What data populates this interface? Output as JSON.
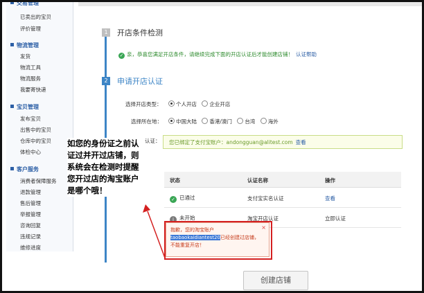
{
  "sidebar": {
    "groups": [
      {
        "head": "交易管理",
        "items": [
          "已卖出的宝贝",
          "评价管理"
        ]
      },
      {
        "head": "物流管理",
        "items": [
          "发货",
          "物流工具",
          "物流服务",
          "我要寄快递"
        ]
      },
      {
        "head": "宝贝管理",
        "items": [
          "发布宝贝",
          "出售中的宝贝",
          "仓库中的宝贝",
          "体检中心"
        ]
      },
      {
        "head": "客户服务",
        "items": [
          "消费者保障服务",
          "退款管理",
          "售后管理",
          "举报管理",
          "咨询回复",
          "违规记录",
          "维修进度"
        ]
      }
    ]
  },
  "steps": [
    {
      "num": "1",
      "title": "开店条件检测"
    },
    {
      "num": "2",
      "title": "申请开店认证"
    }
  ],
  "notice": {
    "message": "亲，恭喜您满足开店条件，请继续完成下面的开店认证后才能创建店铺！",
    "link": "认证帮助"
  },
  "form": {
    "shop_type_label": "选择开店类型：",
    "shop_type_options": [
      "个人开店",
      "企业开店"
    ],
    "location_label": "选择所在地：",
    "location_options": [
      "中国大陆",
      "香港/澳门",
      "台湾",
      "海外"
    ],
    "auth_label": "认证：",
    "alipay_text": "您已绑定了支付宝账户：andongguan@alitest.com",
    "alipay_link": "查看"
  },
  "table": {
    "headers": [
      "状态",
      "认证名称",
      "操作"
    ],
    "rows": [
      {
        "status": "已通过",
        "name": "支付宝实名认证",
        "action": "查看"
      },
      {
        "status": "未开始",
        "name": "淘宝开店认证",
        "action": "立即认证"
      }
    ]
  },
  "popup": {
    "prefix": "抱歉，您的淘宝账户",
    "account": "taobaokaidiantest20",
    "suffix": "已经创建过店铺，不能重复开店！",
    "close": "×"
  },
  "create_button": "创建店铺",
  "annotation": "如您的身份证之前认证过并开过店铺，则系统会在检测时提醒您开过店的淘宝账户是哪个哦！",
  "colors": {
    "accent": "#3d85c6",
    "success": "#3aa655",
    "error": "#d42020"
  }
}
